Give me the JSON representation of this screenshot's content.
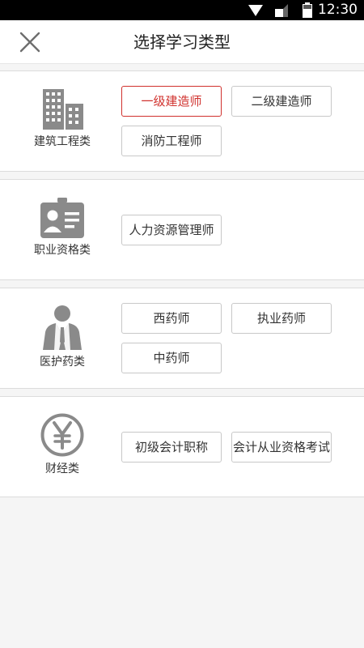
{
  "status_bar": {
    "time": "12:30",
    "icons": [
      "wifi-icon",
      "signal-icon",
      "battery-icon"
    ]
  },
  "header": {
    "title": "选择学习类型",
    "close_icon": "close-icon"
  },
  "theme": {
    "accent": "#d0312d",
    "icon_gray": "#8a8a8a"
  },
  "sections": [
    {
      "icon": "building-icon",
      "label": "建筑工程类",
      "options": [
        "一级建造师",
        "二级建造师",
        "消防工程师"
      ],
      "selected": "一级建造师"
    },
    {
      "icon": "id-card-icon",
      "label": "职业资格类",
      "options": [
        "人力资源管理师"
      ]
    },
    {
      "icon": "doctor-icon",
      "label": "医护药类",
      "options": [
        "西药师",
        "执业药师",
        "中药师"
      ]
    },
    {
      "icon": "yuan-icon",
      "label": "财经类",
      "options": [
        "初级会计职称",
        "会计从业资格考试"
      ]
    }
  ]
}
